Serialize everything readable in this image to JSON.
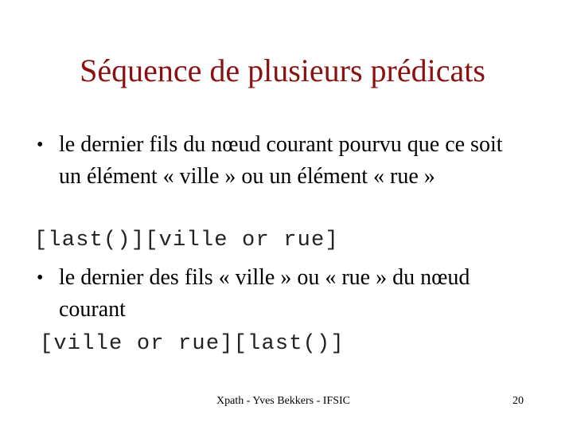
{
  "slide": {
    "title": "Séquence de plusieurs prédicats",
    "title_color": "#8b1111",
    "bullets": [
      {
        "icon": "bullet-dot",
        "glyph": "•",
        "text": "le dernier fils du nœud courant pourvu que ce soit un élément « ville » ou un élément « rue »",
        "code": "[last()][ville or rue]"
      },
      {
        "icon": "bullet-dot",
        "glyph": "•",
        "text": "le dernier des fils « ville » ou « rue » du nœud courant",
        "code": "[ville or rue][last()]"
      }
    ],
    "footer": {
      "text": "Xpath - Yves Bekkers - IFSIC",
      "page_number": "20"
    }
  }
}
